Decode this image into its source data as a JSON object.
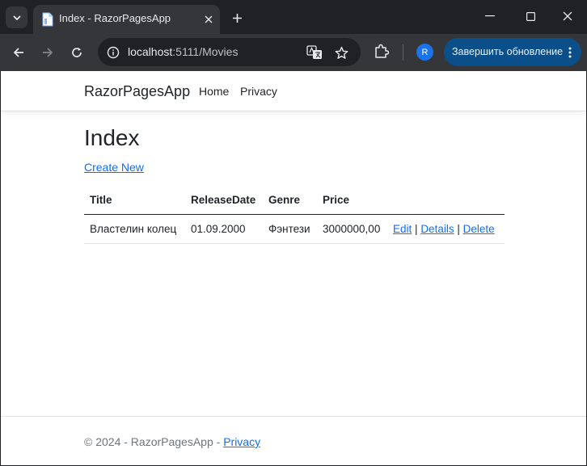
{
  "browser": {
    "tab_title": "Index - RazorPagesApp",
    "url_host": "localhost",
    "url_path": ":5111/Movies",
    "profile_initial": "R",
    "update_label": "Завершить обновление",
    "icons": [
      "tab-search-icon",
      "page-icon",
      "close-icon",
      "plus-icon",
      "minimize-icon",
      "maximize-icon",
      "window-close-icon",
      "back-icon",
      "forward-icon",
      "reload-icon",
      "info-icon",
      "translate-icon",
      "star-icon",
      "extensions-icon",
      "more-vert-icon"
    ]
  },
  "site": {
    "brand": "RazorPagesApp",
    "nav": [
      "Home",
      "Privacy"
    ]
  },
  "page": {
    "title": "Index",
    "create_new": "Create New"
  },
  "table": {
    "headers": [
      "Title",
      "ReleaseDate",
      "Genre",
      "Price"
    ],
    "rows": [
      {
        "title": "Властелин колец",
        "release_date": "01.09.2000",
        "genre": "Фэнтези",
        "price": "3000000,00",
        "actions": [
          "Edit",
          "Details",
          "Delete"
        ],
        "separator": "|"
      }
    ]
  },
  "footer": {
    "text": "© 2024 - RazorPagesApp - ",
    "link": "Privacy"
  },
  "colors": {
    "chrome_dark": "#202124",
    "chrome_toolbar": "#35363a",
    "update_button": "#0b4f8a",
    "link": "#0d6efd",
    "text": "#212529",
    "muted": "#6c757d"
  }
}
